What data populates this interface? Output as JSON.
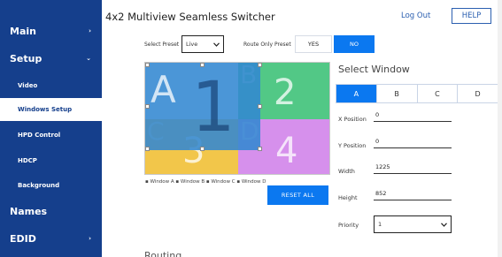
{
  "sidebar": {
    "items": [
      {
        "label": "Main",
        "chevron": "›"
      },
      {
        "label": "Setup",
        "chevron": "⌄"
      },
      {
        "label": "Video"
      },
      {
        "label": "Windows Setup"
      },
      {
        "label": "HPD Control"
      },
      {
        "label": "HDCP"
      },
      {
        "label": "Background"
      },
      {
        "label": "Names"
      },
      {
        "label": "EDID",
        "chevron": "›"
      }
    ]
  },
  "header": {
    "title": "4x2 Multiview Seamless Switcher",
    "logout": "Log Out",
    "help": "HELP"
  },
  "preset": {
    "label": "Select Preset",
    "value": "Live",
    "route_label": "Route Only Preset",
    "yes": "YES",
    "no": "NO"
  },
  "canvas": {
    "win_a": "A",
    "win_one": "1",
    "win_b": "B",
    "win_two": "2",
    "win_c": "C",
    "win_three": "3",
    "win_d": "D",
    "win_four": "4",
    "legend": "▪ Window A ▪ Window B ▪ Window C ▪ Window D",
    "reset": "RESET ALL",
    "colors": {
      "a": "#3287d2",
      "b": "#52c886",
      "c": "#f2c64a",
      "d": "#d690ec"
    }
  },
  "panel": {
    "title": "Select Window",
    "tabs": [
      "A",
      "B",
      "C",
      "D"
    ],
    "x_label": "X Position",
    "x_value": "0",
    "y_label": "Y Position",
    "y_value": "0",
    "w_label": "Width",
    "w_value": "1225",
    "h_label": "Height",
    "h_value": "852",
    "p_label": "Priority",
    "p_value": "1"
  },
  "routing_title": "Routing"
}
